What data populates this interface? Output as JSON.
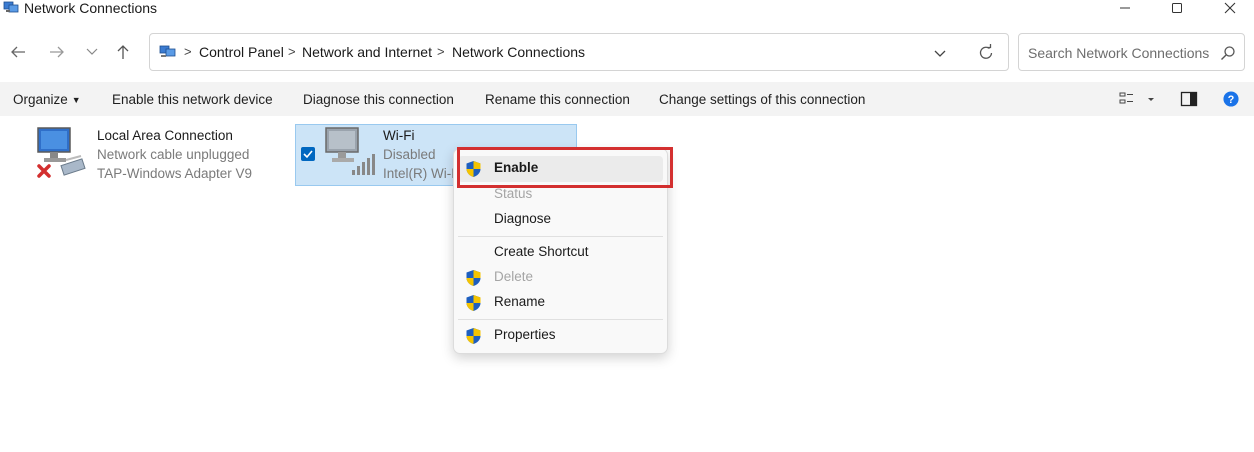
{
  "window": {
    "title": "Network Connections",
    "controls": {
      "minimize": "minimize",
      "maximize": "maximize",
      "close": "close"
    }
  },
  "address": {
    "crumbs": [
      "Control Panel",
      "Network and Internet",
      "Network Connections"
    ],
    "separator": ">",
    "search_placeholder": "Search Network Connections"
  },
  "commands": {
    "organize": "Organize",
    "enable": "Enable this network device",
    "diagnose": "Diagnose this connection",
    "rename": "Rename this connection",
    "change": "Change settings of this connection"
  },
  "connections": [
    {
      "name": "Local Area Connection",
      "status": "Network cable unplugged",
      "adapter": "TAP-Windows Adapter V9",
      "icon": "ethernet-adapter-icon",
      "selected": false
    },
    {
      "name": "Wi-Fi",
      "status": "Disabled",
      "adapter": "Intel(R) Wi-F",
      "icon": "wifi-adapter-icon",
      "selected": true
    }
  ],
  "context_menu": {
    "items": [
      {
        "label": "Enable",
        "shield": true,
        "disabled": false,
        "bold": true
      },
      {
        "label": "Status",
        "shield": false,
        "disabled": true,
        "bold": false
      },
      {
        "label": "Diagnose",
        "shield": false,
        "disabled": false,
        "bold": false
      },
      {
        "label": "Create Shortcut",
        "shield": false,
        "disabled": false,
        "bold": false
      },
      {
        "label": "Delete",
        "shield": true,
        "disabled": true,
        "bold": false
      },
      {
        "label": "Rename",
        "shield": true,
        "disabled": false,
        "bold": false
      },
      {
        "label": "Properties",
        "shield": true,
        "disabled": false,
        "bold": false
      }
    ],
    "highlight_color": "#d32f2f"
  },
  "colors": {
    "accent": "#0067c0",
    "selection": "#cce4f7",
    "help": "#1a73e8"
  }
}
